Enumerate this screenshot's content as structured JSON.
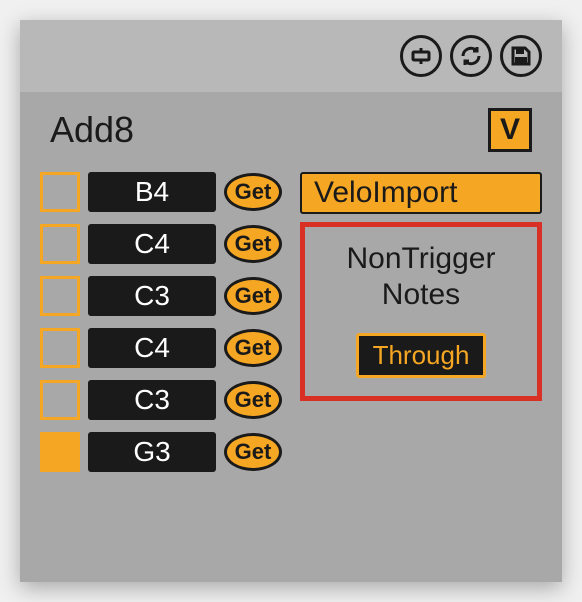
{
  "header": {
    "title": "Add8",
    "v_label": "V"
  },
  "note_rows": [
    {
      "checked": false,
      "note": "B4",
      "button": "Get"
    },
    {
      "checked": false,
      "note": "C4",
      "button": "Get"
    },
    {
      "checked": false,
      "note": "C3",
      "button": "Get"
    },
    {
      "checked": false,
      "note": "C4",
      "button": "Get"
    },
    {
      "checked": false,
      "note": "C3",
      "button": "Get"
    },
    {
      "checked": true,
      "note": "G3",
      "button": "Get"
    }
  ],
  "right": {
    "velo_import": "VeloImport",
    "nontrigger_label_line1": "NonTrigger",
    "nontrigger_label_line2": "Notes",
    "through_label": "Through"
  }
}
